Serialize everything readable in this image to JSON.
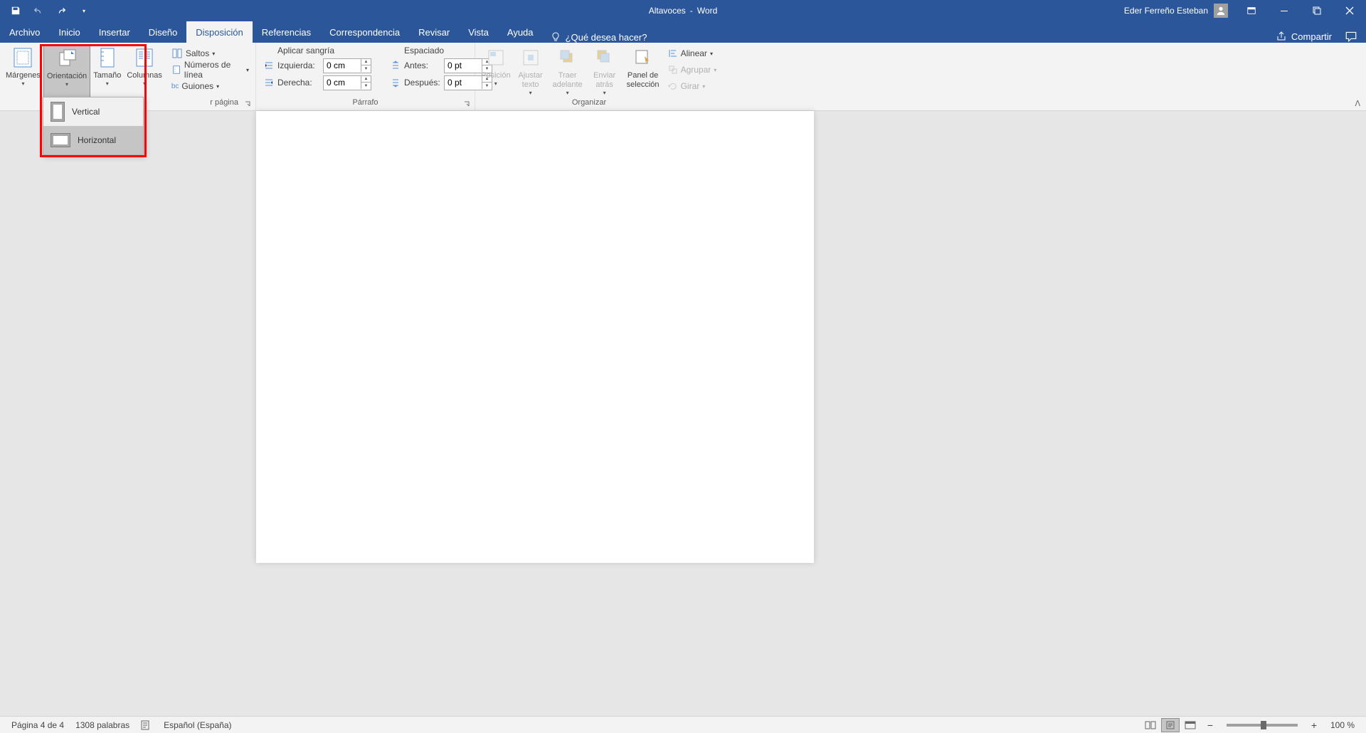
{
  "title": {
    "doc": "Altavoces",
    "sep": "-",
    "app": "Word"
  },
  "user": "Eder Ferreño Esteban",
  "tabs": {
    "archivo": "Archivo",
    "inicio": "Inicio",
    "insertar": "Insertar",
    "diseno": "Diseño",
    "disposicion": "Disposición",
    "referencias": "Referencias",
    "correspondencia": "Correspondencia",
    "revisar": "Revisar",
    "vista": "Vista",
    "ayuda": "Ayuda"
  },
  "tellme": "¿Qué desea hacer?",
  "share": "Compartir",
  "ribbon": {
    "page_setup": {
      "margenes": "Márgenes",
      "orientacion": "Orientación",
      "tamano": "Tamaño",
      "columnas": "Columnas",
      "saltos": "Saltos",
      "numeros": "Números de línea",
      "guiones": "Guiones",
      "group": "r página"
    },
    "orientation_menu": {
      "vertical": "Vertical",
      "horizontal": "Horizontal"
    },
    "paragraph": {
      "sangria_hdr": "Aplicar sangría",
      "espaciado_hdr": "Espaciado",
      "izq": "Izquierda:",
      "der": "Derecha:",
      "antes": "Antes:",
      "despues": "Después:",
      "izq_v": "0 cm",
      "der_v": "0 cm",
      "antes_v": "0 pt",
      "despues_v": "0 pt",
      "group": "Párrafo"
    },
    "arrange": {
      "pos": "Posición",
      "ajustar": "Ajustar texto",
      "traer": "Traer adelante",
      "enviar": "Enviar atrás",
      "panel": "Panel de selección",
      "alinear": "Alinear",
      "agrupar": "Agrupar",
      "girar": "Girar",
      "group": "Organizar"
    }
  },
  "status": {
    "page": "Página 4 de 4",
    "words": "1308 palabras",
    "lang": "Español (España)",
    "zoom": "100 %"
  }
}
